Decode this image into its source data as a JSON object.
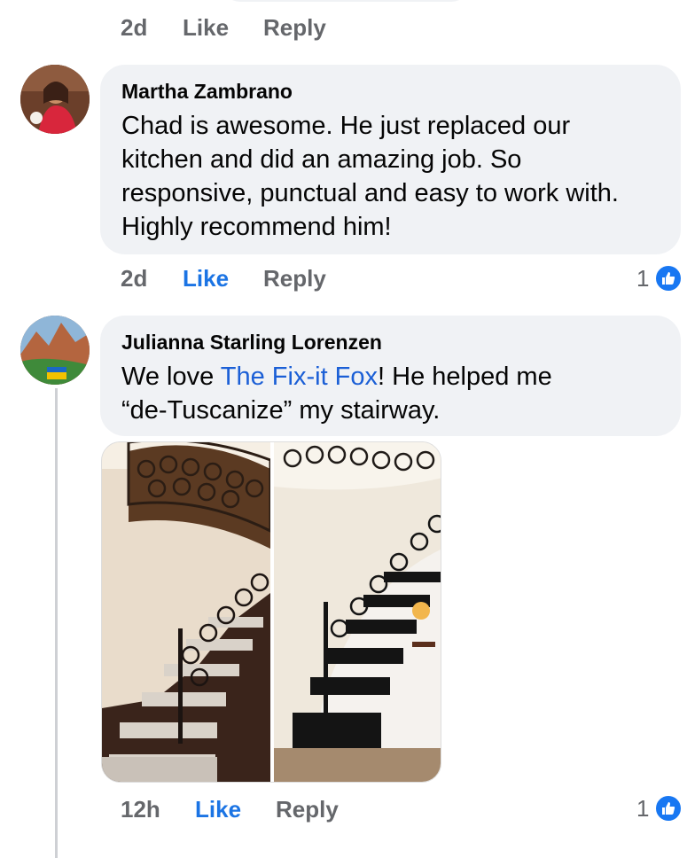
{
  "comments": [
    {
      "time": "2d",
      "like_label": "Like",
      "reply_label": "Reply"
    },
    {
      "author": "Martha Zambrano",
      "text": "Chad is awesome. He just replaced our kitchen and did an amazing job. So responsive, punctual and easy to work with. Highly recommend him!",
      "time": "2d",
      "like_label": "Like",
      "reply_label": "Reply",
      "liked": true,
      "reaction_count": "1",
      "reaction_icon": "thumbs-up-icon"
    },
    {
      "author": "Julianna Starling Lorenzen",
      "text_before": "We love ",
      "mention": "The Fix-it Fox",
      "text_after": "! He helped me “de-Tuscanize” my stairway.",
      "time": "12h",
      "like_label": "Like",
      "reply_label": "Reply",
      "liked": true,
      "reaction_count": "1",
      "reaction_icon": "thumbs-up-icon",
      "image_icon": "before-after-stairway-photo"
    }
  ],
  "colors": {
    "bubble": "#f0f2f5",
    "like_active": "#1b74e4",
    "meta_text": "#65676b",
    "mention_link": "#1b5fd6"
  }
}
